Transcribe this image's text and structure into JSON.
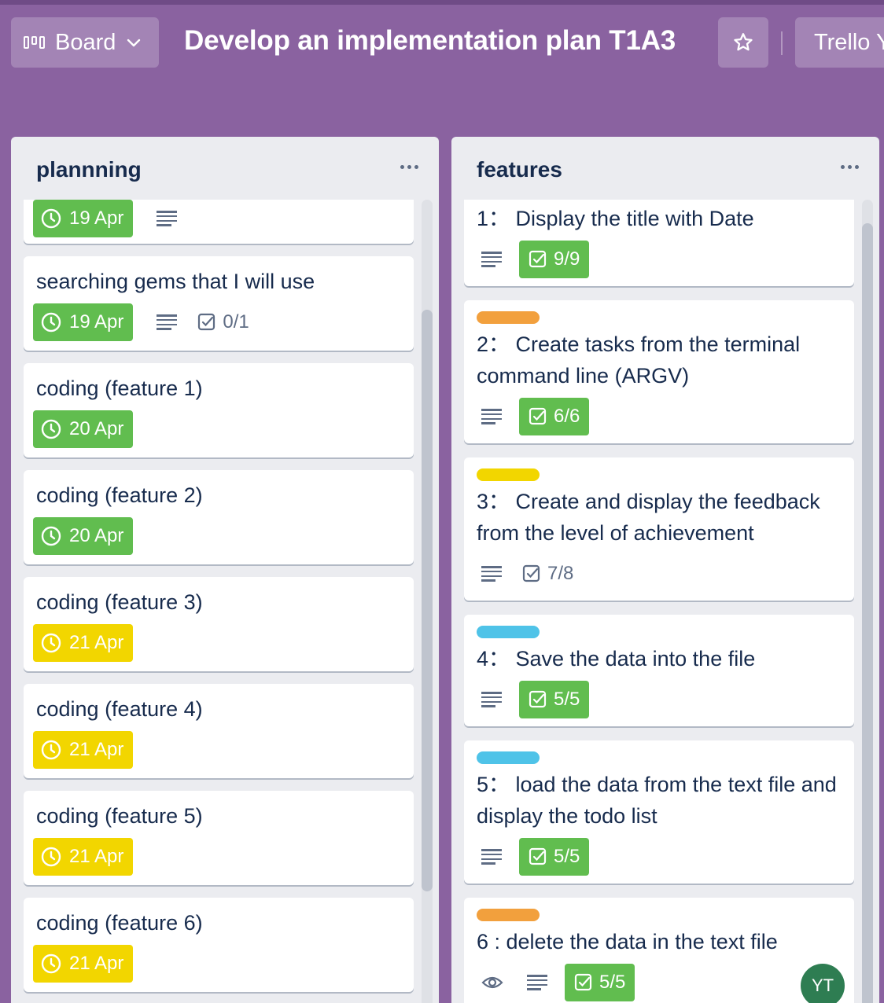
{
  "header": {
    "board_label": "Board",
    "board_title": "Develop an implementation plan T1A3",
    "workspace_label": "Trello Y"
  },
  "colors": {
    "background": "#8a62a0",
    "label_orange": "#f2a03d",
    "label_yellow": "#f2d600",
    "label_sky": "#4fc3e8",
    "due_green": "#61bd4f",
    "due_yellow": "#f2d600"
  },
  "lists": [
    {
      "title": "plannning",
      "cards": [
        {
          "title": "",
          "due": "19 Apr",
          "due_color": "green",
          "has_description": true
        },
        {
          "title": "searching gems that I will use",
          "due": "19 Apr",
          "due_color": "green",
          "has_description": true,
          "checklist": "0/1"
        },
        {
          "title": "coding (feature 1)",
          "due": "20 Apr",
          "due_color": "green"
        },
        {
          "title": "coding (feature 2)",
          "due": "20 Apr",
          "due_color": "green"
        },
        {
          "title": "coding (feature 3)",
          "due": "21 Apr",
          "due_color": "yellow"
        },
        {
          "title": "coding (feature 4)",
          "due": "21 Apr",
          "due_color": "yellow"
        },
        {
          "title": "coding (feature 5)",
          "due": "21 Apr",
          "due_color": "yellow"
        },
        {
          "title": "coding (feature 6)",
          "due": "21 Apr",
          "due_color": "yellow"
        }
      ]
    },
    {
      "title": "features",
      "cards": [
        {
          "title": " 1： Display the title with Date",
          "has_description": true,
          "checklist": "9/9",
          "checklist_complete": true
        },
        {
          "label": "orange",
          "title": " 2： Create tasks from the terminal command line (ARGV)",
          "has_description": true,
          "checklist": "6/6",
          "checklist_complete": true
        },
        {
          "label": "yellow",
          "title": "3： Create and display the feedback from the level of achievement",
          "has_description": true,
          "checklist": "7/8",
          "checklist_complete": false
        },
        {
          "label": "sky",
          "title": "4： Save the data into the file",
          "has_description": true,
          "checklist": "5/5",
          "checklist_complete": true
        },
        {
          "label": "sky",
          "title": " 5： load the data from the text file and display the todo list",
          "has_description": true,
          "checklist": "5/5",
          "checklist_complete": true
        },
        {
          "label": "orange",
          "title": " 6 : delete the data in the text file",
          "watching": true,
          "has_description": true,
          "checklist": "5/5",
          "checklist_complete": true,
          "member": "YT"
        }
      ]
    }
  ]
}
